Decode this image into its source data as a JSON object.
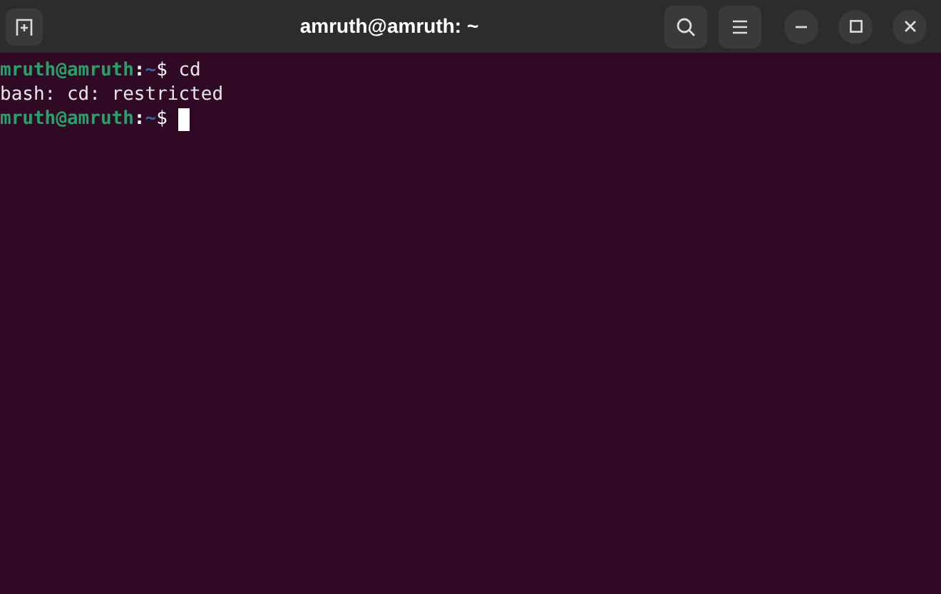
{
  "window": {
    "title": "amruth@amruth: ~"
  },
  "terminal": {
    "lines": [
      {
        "kind": "prompt",
        "user": "mruth@amruth",
        "separator": ":",
        "path": "~",
        "symbol": "$",
        "command": "cd",
        "cursor": false
      },
      {
        "kind": "output",
        "text": "bash: cd: restricted"
      },
      {
        "kind": "prompt",
        "user": "mruth@amruth",
        "separator": ":",
        "path": "~",
        "symbol": "$",
        "cursor": true
      }
    ]
  }
}
